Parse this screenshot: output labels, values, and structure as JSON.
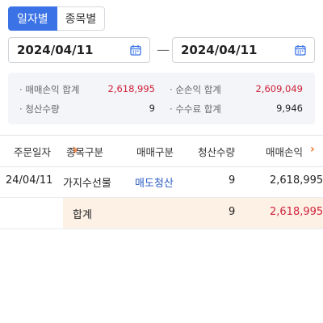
{
  "tabs": [
    {
      "label": "일자별",
      "active": true
    },
    {
      "label": "종목별",
      "active": false
    }
  ],
  "date_range": {
    "start": "2024/04/11",
    "separator": "—",
    "end": "2024/04/11",
    "icon": "calendar-icon"
  },
  "summary": {
    "trade_pl_label": "매매손익 합계",
    "trade_pl_value": "2,618,995",
    "net_pl_label": "순손익 합계",
    "net_pl_value": "2,609,049",
    "settle_qty_label": "청산수량",
    "settle_qty_value": "9",
    "fee_label": "수수료 합계",
    "fee_value": "9,946"
  },
  "table": {
    "headers": [
      "주문일자",
      "종목구분",
      "매매구분",
      "청산수량",
      "매매손익"
    ],
    "rows": [
      {
        "date": "24/04/11",
        "item_type": "가지수선물",
        "trade_type": "매도청산",
        "qty": "9",
        "pl": "2,618,995"
      }
    ],
    "total": {
      "label": "합계",
      "qty": "9",
      "pl": "2,618,995"
    }
  },
  "colors": {
    "accent": "#3b73e6",
    "negative_red": "#d0213a",
    "link_blue": "#2a5bc4",
    "total_bg": "#fdf1e6"
  }
}
